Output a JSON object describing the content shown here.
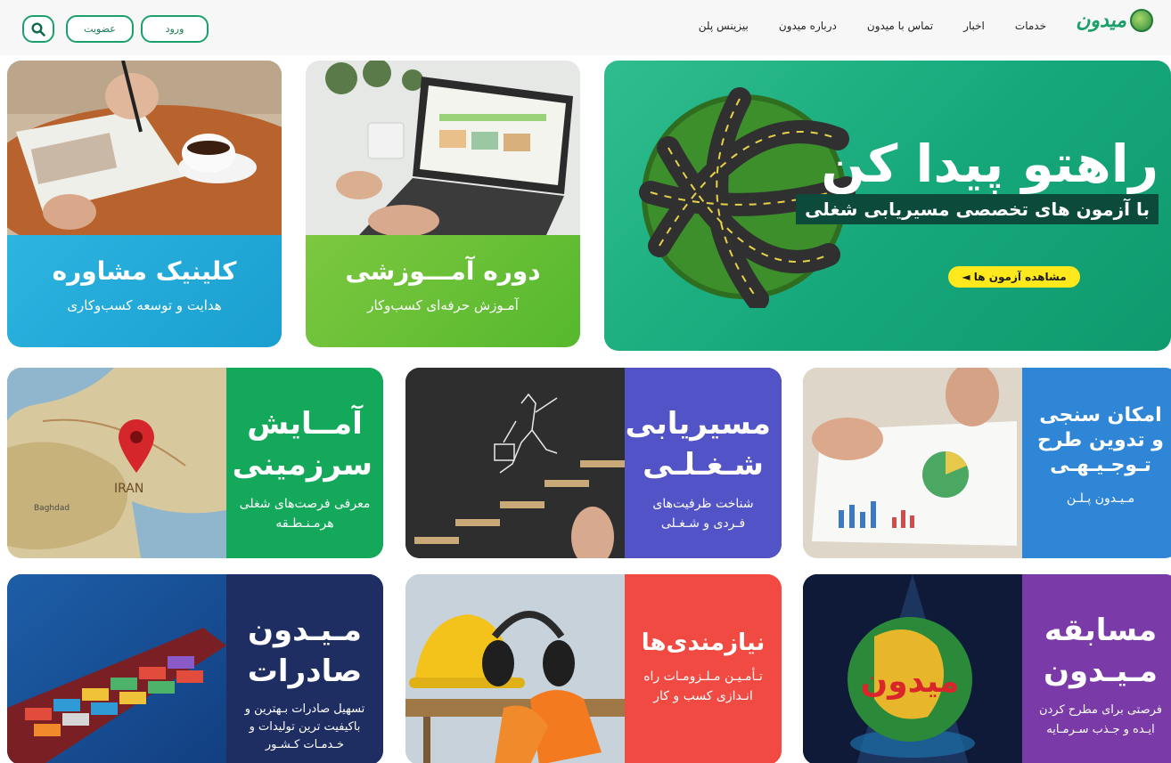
{
  "header": {
    "logo_text": "میدون",
    "nav": [
      "خدمات",
      "اخبار",
      "تماس با میدون",
      "درباره میدون",
      "بیزینس پلن"
    ],
    "login_label": "ورود",
    "join_label": "عضویت"
  },
  "hero": {
    "title": "راهتو پیدا کن",
    "subtitle": "با آزمون های تخصصی مسیریابی شغلی",
    "button_label": "مشاهده آزمون ها ◄"
  },
  "course": {
    "title": "دوره آمـــوزشی",
    "subtitle": "آمـوزش حرفه‌ای کسب‌وکار"
  },
  "clinic": {
    "title": "کلینیک مشاوره",
    "subtitle": "هدایت و توسعه کسب‌وکاری"
  },
  "cards": {
    "plan": {
      "title": "امکان سنجی و تدوین طرح تـوجـیـهـی",
      "subtitle": "مـیـدون پـلـن"
    },
    "career": {
      "title": "مسیریابی شـغـلـی",
      "subtitle": "شناخت ظرفیت‌های فـردی و شـغـلی"
    },
    "land": {
      "title": "آمــایش سرزمینی",
      "subtitle": "معرفی فرصت‌های شغلی هرمـنـطـقه"
    },
    "contest": {
      "title": "مسابقه مـیـدون",
      "subtitle": "فرصتی برای مطرح کردن ایـده و جـذب سـرمـایه"
    },
    "need": {
      "title": "نیازمندی‌ها",
      "subtitle": "تـأمـیـن مـلـزومـات راه انـدازی کسب و کار"
    },
    "export": {
      "title": "مـیـدون صادرات",
      "subtitle": "تسهیل صادرات بـهترین و باکیفیت ترین تولیدات و خـدمـات کـشـور"
    }
  },
  "images": {
    "map_label": "IRAN",
    "map_city": "Baghdad",
    "contest_logo": "میدون"
  },
  "colors": {
    "brand_green": "#1aa06a",
    "hero_bg": "#15a77a",
    "hero_button": "#ffe81c",
    "plan_panel": "#2f86d6",
    "career_panel": "#5153c6",
    "land_panel": "#14a85a",
    "contest_panel": "#7a3aa8",
    "need_panel": "#f04a42",
    "export_panel": "#1e2d62"
  },
  "icons": [
    "search-icon",
    "logo-globe-icon",
    "map-pin-icon"
  ]
}
